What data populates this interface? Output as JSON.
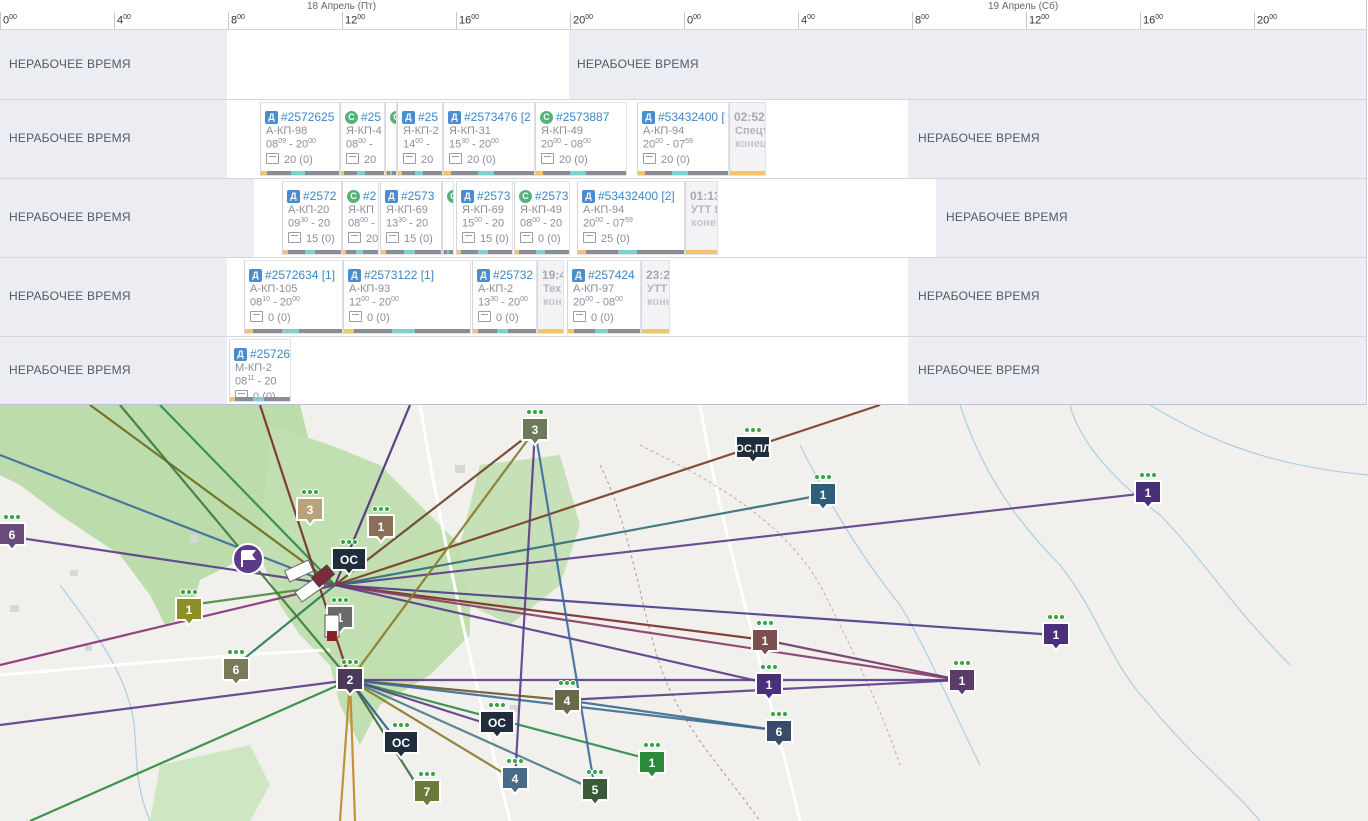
{
  "timeline": {
    "dates": [
      "18 Апрель (Пт)",
      "19 Апрель (Сб)"
    ],
    "ticks": [
      {
        "h": "0",
        "m": "00"
      },
      {
        "h": "4",
        "m": "00"
      },
      {
        "h": "8",
        "m": "00"
      },
      {
        "h": "12",
        "m": "00"
      },
      {
        "h": "16",
        "m": "00"
      },
      {
        "h": "20",
        "m": "00"
      },
      {
        "h": "0",
        "m": "00"
      },
      {
        "h": "4",
        "m": "00"
      },
      {
        "h": "8",
        "m": "00"
      },
      {
        "h": "12",
        "m": "00"
      },
      {
        "h": "16",
        "m": "00"
      },
      {
        "h": "20",
        "m": "00"
      }
    ]
  },
  "nonworking_label": "НЕРАБОЧЕЕ ВРЕМЯ",
  "lanes": [
    {
      "cards": []
    },
    {
      "cards": [
        {
          "badge": "Д",
          "id": "#2572625",
          "route": "А-КП-98",
          "t1": "08",
          "m1": "09",
          "t2": "20",
          "m2": "00",
          "load": "20 (0)"
        },
        {
          "badge": "С",
          "id": "#25",
          "route": "Я-КП-4",
          "t1": "08",
          "m1": "00",
          "t2": "",
          "m2": "",
          "load": "20"
        },
        {
          "badge": "С",
          "id": "",
          "route": "",
          "t1": "",
          "m1": "",
          "t2": "",
          "m2": "",
          "load": ""
        },
        {
          "badge": "Д",
          "id": "#25",
          "route": "Я-КП-2",
          "t1": "14",
          "m1": "00",
          "t2": "",
          "m2": "",
          "load": "20"
        },
        {
          "badge": "Д",
          "id": "#2573476 [2",
          "route": "Я-КП-31",
          "t1": "15",
          "m1": "30",
          "t2": "20",
          "m2": "00",
          "load": "20 (0)"
        },
        {
          "badge": "С",
          "id": "#2573887",
          "route": "Я-КП-49",
          "t1": "20",
          "m1": "00",
          "t2": "08",
          "m2": "00",
          "load": "20 (0)"
        },
        {
          "badge": "Д",
          "id": "#53432400 [",
          "route": "А-КП-94",
          "t1": "20",
          "m1": "00",
          "t2": "07",
          "m2": "59",
          "load": "20 (0)"
        },
        {
          "ghost": true,
          "id": "02:52",
          "route": "Спецт",
          "t1": "конец"
        }
      ]
    },
    {
      "cards": [
        {
          "badge": "Д",
          "id": "#2572",
          "route": "А-КП-20",
          "t1": "09",
          "m1": "30",
          "t2": "20",
          "m2": "",
          "load": "15 (0)"
        },
        {
          "badge": "С",
          "id": "#2",
          "route": "Я-КП",
          "t1": "08",
          "m1": "00",
          "t2": "",
          "m2": "",
          "load": "20"
        },
        {
          "badge": "Д",
          "id": "#2573",
          "route": "Я-КП-69",
          "t1": "13",
          "m1": "30",
          "t2": "20",
          "m2": "",
          "load": "15 (0)"
        },
        {
          "badge": "С",
          "id": "",
          "route": "",
          "t1": "",
          "m1": "",
          "t2": "",
          "m2": "",
          "load": ""
        },
        {
          "badge": "Д",
          "id": "#2573",
          "route": "Я-КП-69",
          "t1": "15",
          "m1": "00",
          "t2": "20",
          "m2": "",
          "load": "15 (0)"
        },
        {
          "badge": "С",
          "id": "#2573",
          "route": "Я-КП-49",
          "t1": "08",
          "m1": "00",
          "t2": "20",
          "m2": "",
          "load": "0 (0)"
        },
        {
          "badge": "Д",
          "id": "#53432400 [2]",
          "route": "А-КП-94",
          "t1": "20",
          "m1": "00",
          "t2": "07",
          "m2": "59",
          "load": "25 (0)"
        },
        {
          "ghost": true,
          "id": "01:13",
          "route": "УТТ Я",
          "t1": "конец"
        }
      ]
    },
    {
      "cards": [
        {
          "badge": "Д",
          "id": "#2572634 [1]",
          "route": "А-КП-105",
          "t1": "08",
          "m1": "10",
          "t2": "20",
          "m2": "00",
          "load": "0 (0)"
        },
        {
          "badge": "Д",
          "id": "#2573122 [1]",
          "route": "А-КП-93",
          "t1": "12",
          "m1": "00",
          "t2": "20",
          "m2": "00",
          "load": "0 (0)"
        },
        {
          "badge": "Д",
          "id": "#25732",
          "route": "А-КП-2",
          "t1": "13",
          "m1": "30",
          "t2": "20",
          "m2": "00",
          "load": "0 (0)"
        },
        {
          "ghost": true,
          "id": "19:4",
          "route": "Тех",
          "t1": "кон"
        },
        {
          "badge": "Д",
          "id": "#257424",
          "route": "А-КП-97",
          "t1": "20",
          "m1": "00",
          "t2": "08",
          "m2": "00",
          "load": "0 (0)"
        },
        {
          "ghost": true,
          "id": "23:2",
          "route": "УТТ",
          "t1": "коне"
        }
      ]
    },
    {
      "cards": [
        {
          "badge": "Д",
          "id": "#25726",
          "route": "М-КП-2",
          "t1": "08",
          "m1": "11",
          "t2": "20",
          "m2": "",
          "load": "0 (0)"
        }
      ]
    }
  ],
  "map": {
    "markers": [
      {
        "label": "3"
      },
      {
        "label": "1"
      },
      {
        "label": "3"
      },
      {
        "label": "1"
      },
      {
        "label": "ОС"
      },
      {
        "label": "1"
      },
      {
        "label": "6"
      },
      {
        "label": "6"
      },
      {
        "label": "2"
      },
      {
        "label": "ОС"
      },
      {
        "label": "ОС"
      },
      {
        "label": "4"
      },
      {
        "label": "7"
      },
      {
        "label": "4"
      },
      {
        "label": "5"
      },
      {
        "label": "1"
      },
      {
        "label": "1"
      },
      {
        "label": "1"
      },
      {
        "label": "1"
      },
      {
        "label": "6"
      },
      {
        "label": "1"
      },
      {
        "label": "1"
      },
      {
        "label": "1"
      },
      {
        "label": "ОС,ПЛ"
      }
    ],
    "colors": {
      "accent": "#5b3a8a",
      "water": "#a9d0e3",
      "forest": "#b8d8a8",
      "road": "#ffffff"
    }
  }
}
